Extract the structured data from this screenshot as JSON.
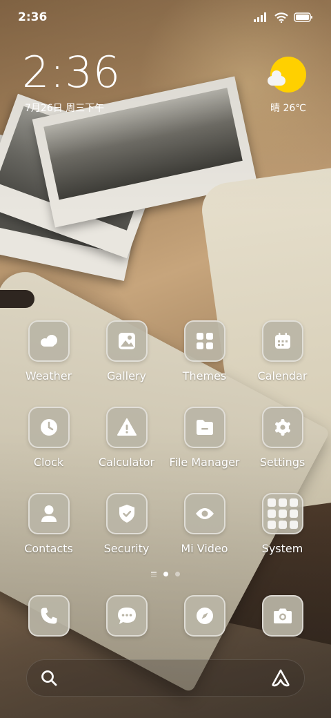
{
  "status_bar": {
    "time": "2:36"
  },
  "clock_widget": {
    "time": "2:36",
    "date": "7月26日 周三下午"
  },
  "weather_widget": {
    "text": "晴 26℃",
    "sun_color": "#ffd000"
  },
  "apps": [
    {
      "label": "Weather",
      "icon": "weather-icon"
    },
    {
      "label": "Gallery",
      "icon": "gallery-icon"
    },
    {
      "label": "Themes",
      "icon": "themes-icon"
    },
    {
      "label": "Calendar",
      "icon": "calendar-icon"
    },
    {
      "label": "Clock",
      "icon": "clock-icon"
    },
    {
      "label": "Calculator",
      "icon": "calculator-icon"
    },
    {
      "label": "File Manager",
      "icon": "file-manager-icon"
    },
    {
      "label": "Settings",
      "icon": "settings-icon"
    },
    {
      "label": "Contacts",
      "icon": "contacts-icon"
    },
    {
      "label": "Security",
      "icon": "security-icon"
    },
    {
      "label": "Mi Video",
      "icon": "mi-video-icon"
    },
    {
      "label": "System",
      "icon": "system-folder-icon"
    }
  ],
  "page_indicator": {
    "pages": 2,
    "active_page": 1
  },
  "dock": [
    {
      "icon": "phone-icon"
    },
    {
      "icon": "messages-icon"
    },
    {
      "icon": "browser-icon"
    },
    {
      "icon": "camera-icon"
    }
  ],
  "search_bar": {
    "left_icon": "search-icon",
    "right_icon": "assistant-icon"
  },
  "colors": {
    "icon_tile": "#bab5a6",
    "text": "#ffffff"
  }
}
